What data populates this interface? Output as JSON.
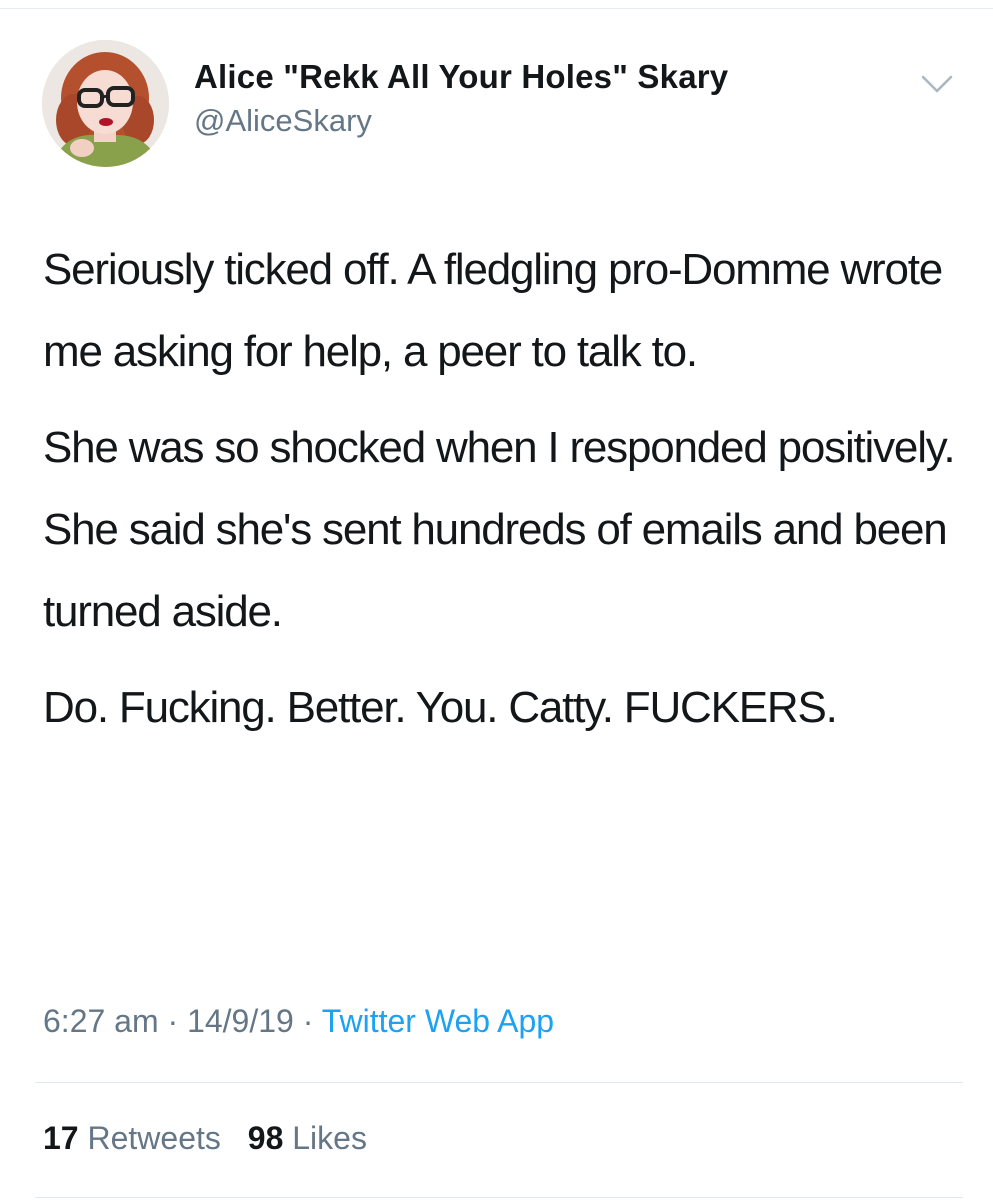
{
  "tweet": {
    "author": {
      "display_name": "Alice \"Rekk All Your Holes\" Skary",
      "handle": "@AliceSkary"
    },
    "paragraphs": [
      "Seriously ticked off. A fledgling pro-Domme wrote me asking for help, a peer to talk to.",
      "She was so shocked when I responded positively. She said she's sent hundreds of emails and been turned aside.",
      "Do. Fucking. Better. You. Catty. FUCKERS."
    ],
    "meta": {
      "time": "6:27 am",
      "separator": "·",
      "date": "14/9/19",
      "source": "Twitter Web App"
    },
    "stats": {
      "retweets_count": "17",
      "retweets_label": "Retweets",
      "likes_count": "98",
      "likes_label": "Likes"
    },
    "icons": {
      "menu": "chevron-down-icon"
    }
  },
  "colors": {
    "text_primary": "#14171a",
    "text_secondary": "#657786",
    "link": "#1da1f2",
    "divider": "#e1e8ed"
  }
}
